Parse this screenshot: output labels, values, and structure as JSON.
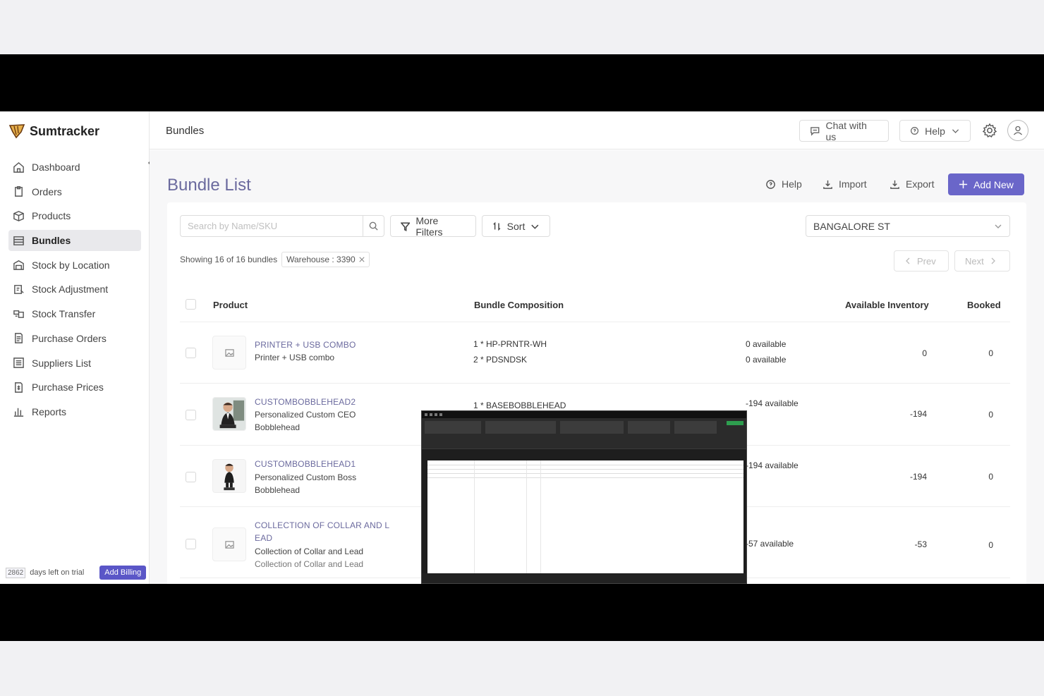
{
  "app": {
    "brand": "Sumtracker",
    "header_title": "Bundles",
    "chat_label": "Chat with us",
    "help_label": "Help"
  },
  "sidebar": {
    "items": [
      {
        "label": "Dashboard",
        "icon": "home-icon"
      },
      {
        "label": "Orders",
        "icon": "clipboard-icon"
      },
      {
        "label": "Products",
        "icon": "box-icon"
      },
      {
        "label": "Bundles",
        "icon": "layers-icon",
        "active": true
      },
      {
        "label": "Stock by Location",
        "icon": "warehouse-icon"
      },
      {
        "label": "Stock Adjustment",
        "icon": "adjust-icon"
      },
      {
        "label": "Stock Transfer",
        "icon": "transfer-icon"
      },
      {
        "label": "Purchase Orders",
        "icon": "document-icon"
      },
      {
        "label": "Suppliers List",
        "icon": "list-icon"
      },
      {
        "label": "Purchase Prices",
        "icon": "price-icon"
      },
      {
        "label": "Reports",
        "icon": "bar-chart-icon"
      }
    ],
    "trial_days": "2862",
    "trial_text": "days left on trial",
    "billing_label": "Add Billing"
  },
  "page": {
    "title": "Bundle List",
    "help_label": "Help",
    "import_label": "Import",
    "export_label": "Export",
    "add_new_label": "Add New"
  },
  "filters": {
    "search_placeholder": "Search by Name/SKU",
    "more_filters_label": "More Filters",
    "sort_label": "Sort",
    "warehouse_value": "BANGALORE ST",
    "showing_text": "Showing 16 of 16 bundles",
    "chip_label": "Warehouse : 3390",
    "prev_label": "Prev",
    "next_label": "Next"
  },
  "table": {
    "headers": {
      "product": "Product",
      "composition": "Bundle Composition",
      "available": "Available Inventory",
      "booked": "Booked"
    },
    "rows": [
      {
        "sku": "PRINTER + USB COMBO",
        "name": "Printer + USB combo",
        "name2": "",
        "extra": "",
        "components": [
          "1 * HP-PRNTR-WH",
          "2 * PDSNDSK"
        ],
        "component_avail": [
          "0 available",
          "0 available"
        ],
        "available": "0",
        "booked": "0"
      },
      {
        "sku": "CUSTOMBOBBLEHEAD2",
        "name": "Personalized Custom CEO",
        "name2": "Bobblehead",
        "extra": "",
        "components": [
          "1 * BASEBOBBLEHEAD"
        ],
        "component_avail": [
          "-194 available"
        ],
        "available": "-194",
        "booked": "0"
      },
      {
        "sku": "CUSTOMBOBBLEHEAD1",
        "name": "Personalized Custom Boss",
        "name2": "Bobblehead",
        "extra": "",
        "components": [],
        "component_avail": [
          "-194 available"
        ],
        "available": "-194",
        "booked": "0"
      },
      {
        "sku": "COLLECTION OF COLLAR AND L",
        "sku2": "EAD",
        "name": "Collection of Collar and Lead",
        "name2": "",
        "extra": "Collection of Collar and Lead",
        "components": [],
        "component_avail": [
          "-57 available"
        ],
        "available": "-53",
        "booked": "0"
      }
    ]
  }
}
